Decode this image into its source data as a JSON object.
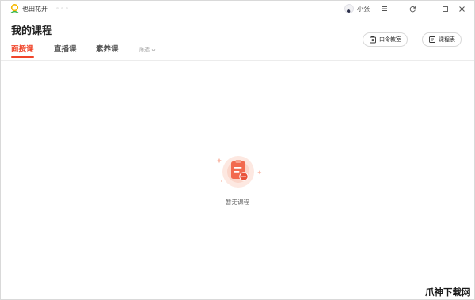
{
  "app": {
    "name": "也田花开",
    "logo_color": "#f5b800"
  },
  "user": {
    "name": "小张"
  },
  "window_controls": [
    "menu-icon",
    "refresh-icon",
    "minimize-icon",
    "maximize-icon",
    "close-icon"
  ],
  "header": {
    "title": "我的课程",
    "tabs": [
      {
        "label": "面授课",
        "active": true
      },
      {
        "label": "直播课",
        "active": false
      },
      {
        "label": "素养课",
        "active": false
      }
    ],
    "filter_label": "筛选",
    "buttons": [
      {
        "label": "口令教室",
        "icon": "lock-icon"
      },
      {
        "label": "课程表",
        "icon": "schedule-icon"
      }
    ]
  },
  "empty_state": {
    "text": "暂无课程",
    "icon": "clipboard-icon"
  },
  "watermark": {
    "text": "爪神下载网"
  },
  "colors": {
    "accent": "#f0452a",
    "illustration": "#f26a4f"
  }
}
